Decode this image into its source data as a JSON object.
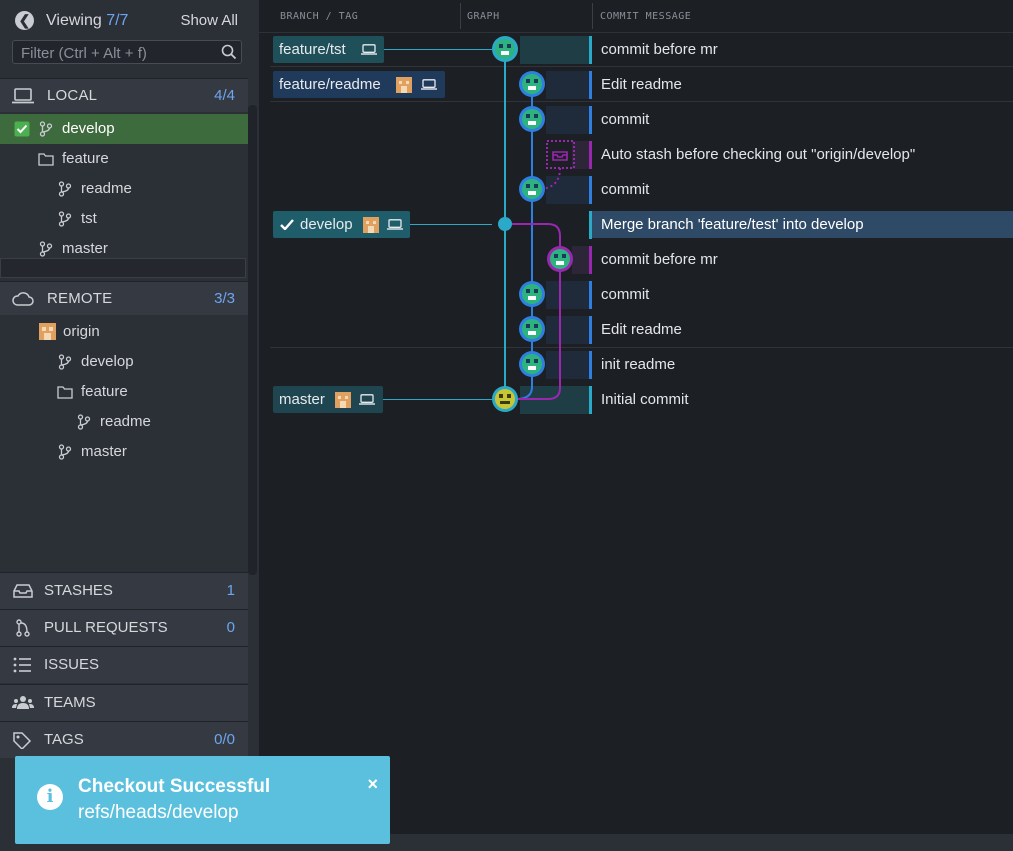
{
  "header": {
    "viewing_label": "Viewing",
    "viewing_count": "7/7",
    "show_all": "Show All"
  },
  "filter": {
    "placeholder": "Filter (Ctrl + Alt + f)"
  },
  "local": {
    "title": "LOCAL",
    "count": "4/4",
    "items": [
      {
        "label": "develop",
        "kind": "branch",
        "checked": true
      },
      {
        "label": "feature",
        "kind": "folder"
      },
      {
        "label": "readme",
        "kind": "branch"
      },
      {
        "label": "tst",
        "kind": "branch"
      },
      {
        "label": "master",
        "kind": "branch"
      }
    ]
  },
  "remote": {
    "title": "REMOTE",
    "count": "3/3",
    "items": [
      {
        "label": "origin",
        "kind": "remote"
      },
      {
        "label": "develop",
        "kind": "branch"
      },
      {
        "label": "feature",
        "kind": "folder"
      },
      {
        "label": "readme",
        "kind": "branch"
      },
      {
        "label": "master",
        "kind": "branch"
      }
    ]
  },
  "bottom_sections": [
    {
      "label": "STASHES",
      "count": "1",
      "icon": "inbox-icon"
    },
    {
      "label": "PULL REQUESTS",
      "count": "0",
      "icon": "pull-request-icon"
    },
    {
      "label": "ISSUES",
      "count": "",
      "icon": "list-icon"
    },
    {
      "label": "TEAMS",
      "count": "",
      "icon": "team-icon"
    },
    {
      "label": "TAGS",
      "count": "0/0",
      "icon": "tag-icon"
    }
  ],
  "columns": {
    "branch_tag": "BRANCH / TAG",
    "graph": "GRAPH",
    "commit_message": "COMMIT MESSAGE"
  },
  "branch_labels": [
    {
      "label": "feature/tst",
      "row": 0,
      "avatar": false,
      "checked": false
    },
    {
      "label": "feature/readme",
      "row": 1,
      "avatar": true,
      "checked": false
    },
    {
      "label": "develop",
      "row": 5,
      "avatar": true,
      "checked": true
    },
    {
      "label": "master",
      "row": 10,
      "avatar": true,
      "checked": false
    }
  ],
  "commits": [
    {
      "message": "commit before mr",
      "lane": "cyan"
    },
    {
      "message": "Edit readme",
      "lane": "blue"
    },
    {
      "message": "commit",
      "lane": "blue"
    },
    {
      "message": "Auto stash before checking out \"origin/develop\"",
      "lane": "purple"
    },
    {
      "message": "commit",
      "lane": "blue"
    },
    {
      "message": "Merge branch 'feature/test' into develop",
      "lane": "cyan"
    },
    {
      "message": "commit before mr",
      "lane": "purple"
    },
    {
      "message": "commit",
      "lane": "blue"
    },
    {
      "message": "Edit readme",
      "lane": "blue"
    },
    {
      "message": "init readme",
      "lane": "blue"
    },
    {
      "message": "Initial commit",
      "lane": "cyan"
    }
  ],
  "toast": {
    "title": "Checkout Successful",
    "message": "refs/heads/develop",
    "close": "×",
    "info_glyph": "i"
  },
  "colors": {
    "cyan": "#2aa9c9",
    "blue": "#2f7fe0",
    "purple": "#9b27b0",
    "active_green": "#3e6b3e",
    "toast": "#5bc0de"
  }
}
